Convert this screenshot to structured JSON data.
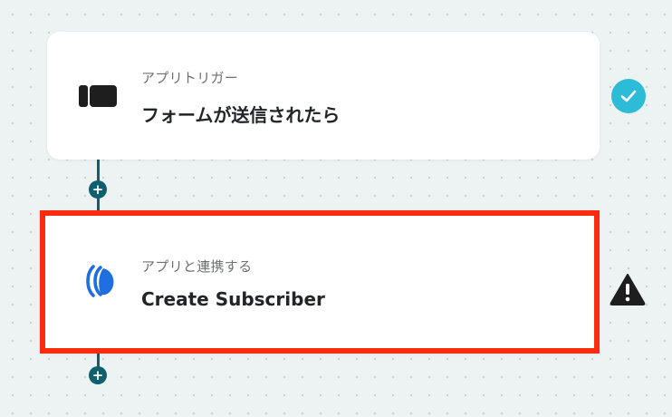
{
  "flow": {
    "steps": [
      {
        "label": "アプリトリガー",
        "title": "フォームが送信されたら",
        "icon": "form-trigger-icon",
        "status": "success"
      },
      {
        "label": "アプリと連携する",
        "title": "Create Subscriber",
        "icon": "app-logo-icon",
        "status": "warning",
        "highlighted": true
      }
    ],
    "add_step_symbol": "+"
  },
  "colors": {
    "connector": "#0f5f6e",
    "highlight_border": "#fc2a0f",
    "success": "#2cbcd8",
    "warning": "#1e1e1e",
    "app_logo": "#1f6fe0"
  }
}
